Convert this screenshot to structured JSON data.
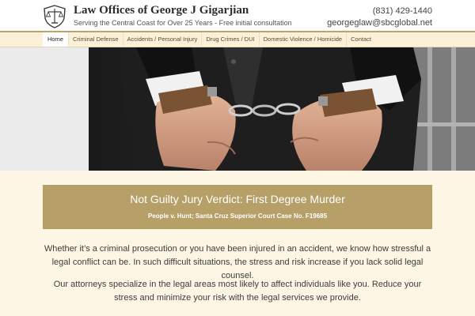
{
  "header": {
    "title": "Law Offices of George J Gigarjian",
    "tagline": "Serving the Central Coast for Over 25 Years - Free initial consultation",
    "phone": "(831) 429-1440",
    "email": "georgeglaw@sbcglobal.net"
  },
  "nav": {
    "items": [
      {
        "label": "Home"
      },
      {
        "label": "Criminal Defense"
      },
      {
        "label": "Accidents / Personal Injury"
      },
      {
        "label": "Drug Crimes / DUI"
      },
      {
        "label": "Domestic Violence / Homicide"
      },
      {
        "label": "Contact"
      }
    ],
    "active": "Home"
  },
  "banner": {
    "title": "Not Guilty Jury Verdict: First Degree Murder",
    "subtitle": "People v. Hunt; Santa Cruz Superior Court Case No. F19685"
  },
  "content": {
    "paragraph1": "Whether it’s a criminal prosecution or you have been injured in an accident, we know how stressful a legal conflict can be. In such difficult situations, the stress and risk increase if you lack solid legal counsel.",
    "paragraph2": "Our attorneys specialize in the legal areas most likely to affect individuals like you. Reduce your stress and minimize your risk with the legal services we provide."
  },
  "colors": {
    "accent": "#b79f68",
    "nav_background": "#fbf1d9",
    "page_background": "#fdf6e4"
  },
  "icons": {
    "logo": "scales-of-justice-shield-icon",
    "hero": "handcuffed-hands-photo"
  }
}
